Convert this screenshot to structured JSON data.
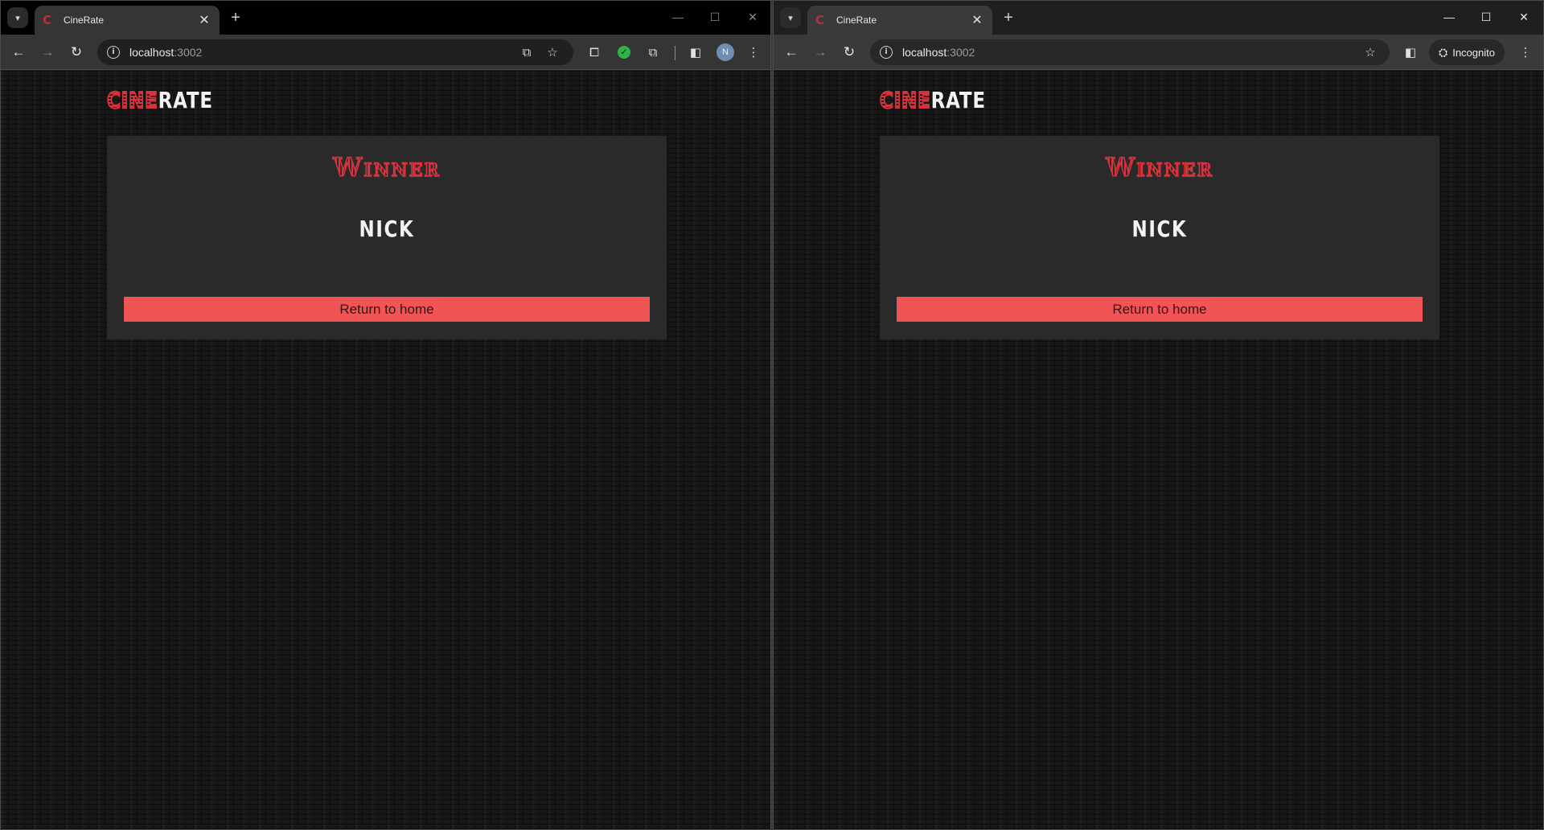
{
  "windows": [
    {
      "tab": {
        "title": "CineRate",
        "favicon": "C"
      },
      "address": {
        "host": "localhost",
        "port": ":3002"
      },
      "mode": "normal",
      "avatar_letter": "N"
    },
    {
      "tab": {
        "title": "CineRate",
        "favicon": "C"
      },
      "address": {
        "host": "localhost",
        "port": ":3002"
      },
      "mode": "incognito",
      "incognito_label": "Incognito"
    }
  ],
  "icons": {
    "tab_search": "▾",
    "tab_close": "✕",
    "new_tab": "+",
    "minimize": "—",
    "maximize": "☐",
    "close": "✕",
    "back": "←",
    "forward": "→",
    "reload": "↻",
    "info": "i",
    "install": "⧉",
    "bookmark": "☆",
    "extension": "⧠",
    "extension_check": "✓",
    "puzzle": "⧉",
    "side_panel": "◧",
    "menu": "⋮",
    "incognito": "⛭"
  },
  "page": {
    "logo": {
      "part1": "CINE",
      "part2": "RATE"
    },
    "result": {
      "heading": "Winner",
      "winner_name": "NICK",
      "button_label": "Return to home"
    }
  },
  "colors": {
    "accent": "#d8323c",
    "button": "#f05454",
    "card": "#2a2a2a"
  }
}
